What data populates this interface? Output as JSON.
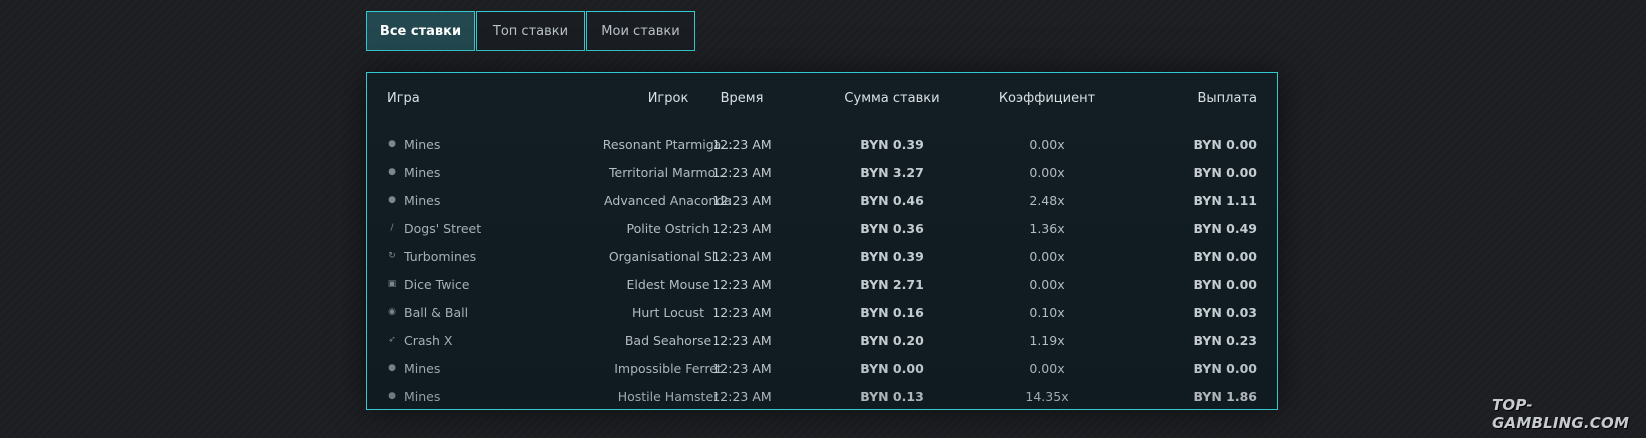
{
  "tabs": [
    {
      "label": "Все ставки",
      "active": true
    },
    {
      "label": "Топ ставки",
      "active": false
    },
    {
      "label": "Мои ставки",
      "active": false
    }
  ],
  "table": {
    "headers": {
      "game": "Игра",
      "player": "Игрок",
      "time": "Время",
      "bet": "Сумма ставки",
      "coef": "Коэффициент",
      "payout": "Выплата"
    },
    "rows": [
      {
        "icon": "bomb-icon",
        "game": "Mines",
        "player": "Resonant Ptarmiga...",
        "time": "12:23 AM",
        "bet": "BYN 0.39",
        "coef": "0.00x",
        "payout": "BYN 0.00"
      },
      {
        "icon": "bomb-icon",
        "game": "Mines",
        "player": "Territorial Marmo...",
        "time": "12:23 AM",
        "bet": "BYN 3.27",
        "coef": "0.00x",
        "payout": "BYN 0.00"
      },
      {
        "icon": "bomb-icon",
        "game": "Mines",
        "player": "Advanced Anaconda",
        "time": "12:23 AM",
        "bet": "BYN 0.46",
        "coef": "2.48x",
        "payout": "BYN 1.11"
      },
      {
        "icon": "bone-icon",
        "game": "Dogs' Street",
        "player": "Polite Ostrich",
        "time": "12:23 AM",
        "bet": "BYN 0.36",
        "coef": "1.36x",
        "payout": "BYN 0.49"
      },
      {
        "icon": "refresh-icon",
        "game": "Turbomines",
        "player": "Organisational Sl...",
        "time": "12:23 AM",
        "bet": "BYN 0.39",
        "coef": "0.00x",
        "payout": "BYN 0.00"
      },
      {
        "icon": "dice-icon",
        "game": "Dice Twice",
        "player": "Eldest Mouse",
        "time": "12:23 AM",
        "bet": "BYN 2.71",
        "coef": "0.00x",
        "payout": "BYN 0.00"
      },
      {
        "icon": "ball-icon",
        "game": "Ball & Ball",
        "player": "Hurt Locust",
        "time": "12:23 AM",
        "bet": "BYN 0.16",
        "coef": "0.10x",
        "payout": "BYN 0.03"
      },
      {
        "icon": "rocket-icon",
        "game": "Crash X",
        "player": "Bad Seahorse",
        "time": "12:23 AM",
        "bet": "BYN 0.20",
        "coef": "1.19x",
        "payout": "BYN 0.23"
      },
      {
        "icon": "bomb-icon",
        "game": "Mines",
        "player": "Impossible Ferret",
        "time": "12:23 AM",
        "bet": "BYN 0.00",
        "coef": "0.00x",
        "payout": "BYN 0.00"
      },
      {
        "icon": "bomb-icon",
        "game": "Mines",
        "player": "Hostile Hamster",
        "time": "12:23 AM",
        "bet": "BYN 0.13",
        "coef": "14.35x",
        "payout": "BYN 1.86"
      }
    ]
  },
  "colors": {
    "accent": "#34c9cf",
    "active_tab_bg": "#234850",
    "page_bg": "#1c1e22",
    "panel_bg": "#121e24"
  },
  "watermark": "TOP-GAMBLING.COM"
}
